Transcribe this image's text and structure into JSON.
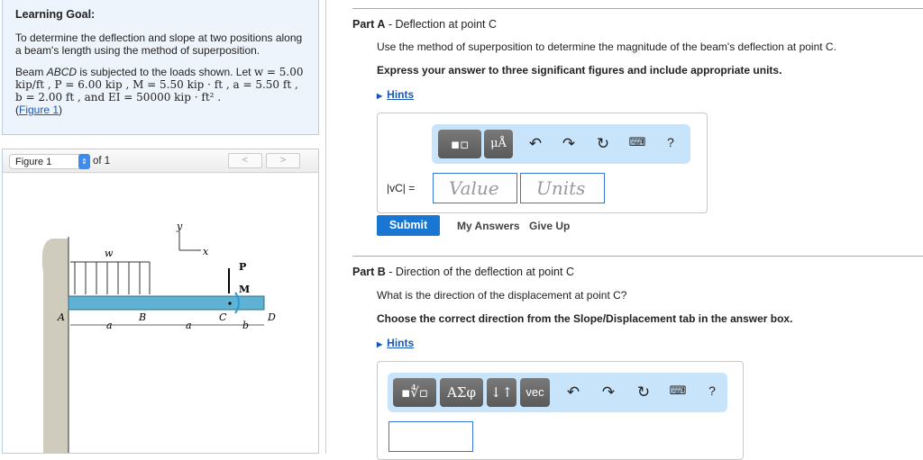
{
  "goal": {
    "title": "Learning Goal:",
    "intro": "To determine the deflection and slope at two positions along a beam's length using the method of superposition.",
    "p1": "Beam ",
    "beam": "ABCD",
    "p2": " is subjected to the loads shown. Let ",
    "w": "w = 5.00 kip/ft , P = 6.00 kip , M = 5.50 kip · ft , a = 5.50 ft , b = 2.00 ft , and EI = 50000 kip · ft² .",
    "fig_link": "Figure 1"
  },
  "figure": {
    "select": "Figure 1",
    "of": "of 1",
    "prev": "<",
    "next": ">",
    "labels": {
      "w": "w",
      "y": "y",
      "x": "x",
      "P": "P",
      "M": "M",
      "A": "A",
      "B": "B",
      "C": "C",
      "D": "D",
      "a": "a",
      "b": "b"
    }
  },
  "partA": {
    "label": "Part A",
    "title": " - Deflection at point C",
    "q": "Use the method of superposition to determine the magnitude of the beam's deflection at point C.",
    "instr": "Express your answer to three significant figures and include appropriate units.",
    "hints": "Hints",
    "tool_units": "μÅ",
    "var": "|vC| =",
    "value_ph": "Value",
    "units_ph": "Units",
    "submit": "Submit",
    "my_answers": "My Answers",
    "give_up": "Give Up",
    "help": "?"
  },
  "partB": {
    "label": "Part B",
    "title": " - Direction of the deflection at point C",
    "q": "What is the direction of the displacement at point C?",
    "instr": "Choose the correct direction from the Slope/Displacement tab in the answer box.",
    "hints": "Hints",
    "greek": "ΑΣφ",
    "arrows": "↓↑",
    "vec": "vec",
    "help": "?"
  }
}
